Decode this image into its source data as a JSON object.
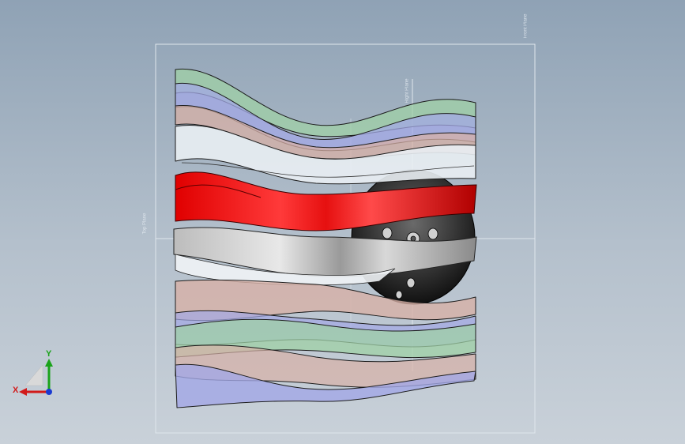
{
  "viewport": {
    "background_top": "#8fa2b5",
    "background_bottom": "#c9d1d9",
    "plane_labels": {
      "front": "Front Plane",
      "top": "Top Plane",
      "right": "Right Plane"
    }
  },
  "model": {
    "shell_colors": [
      "#9fd0a6",
      "#a3a8e6",
      "#d7b0a6",
      "#e9eef3"
    ],
    "highlight_red": "#c40000",
    "highlight_gray": "#9a9a9a",
    "hub_color": "#2a2a2a"
  },
  "triad": {
    "x_label": "X",
    "y_label": "Y",
    "x_color": "#d11a1a",
    "y_color": "#1aa31a",
    "z_color": "#1a3ad1"
  }
}
